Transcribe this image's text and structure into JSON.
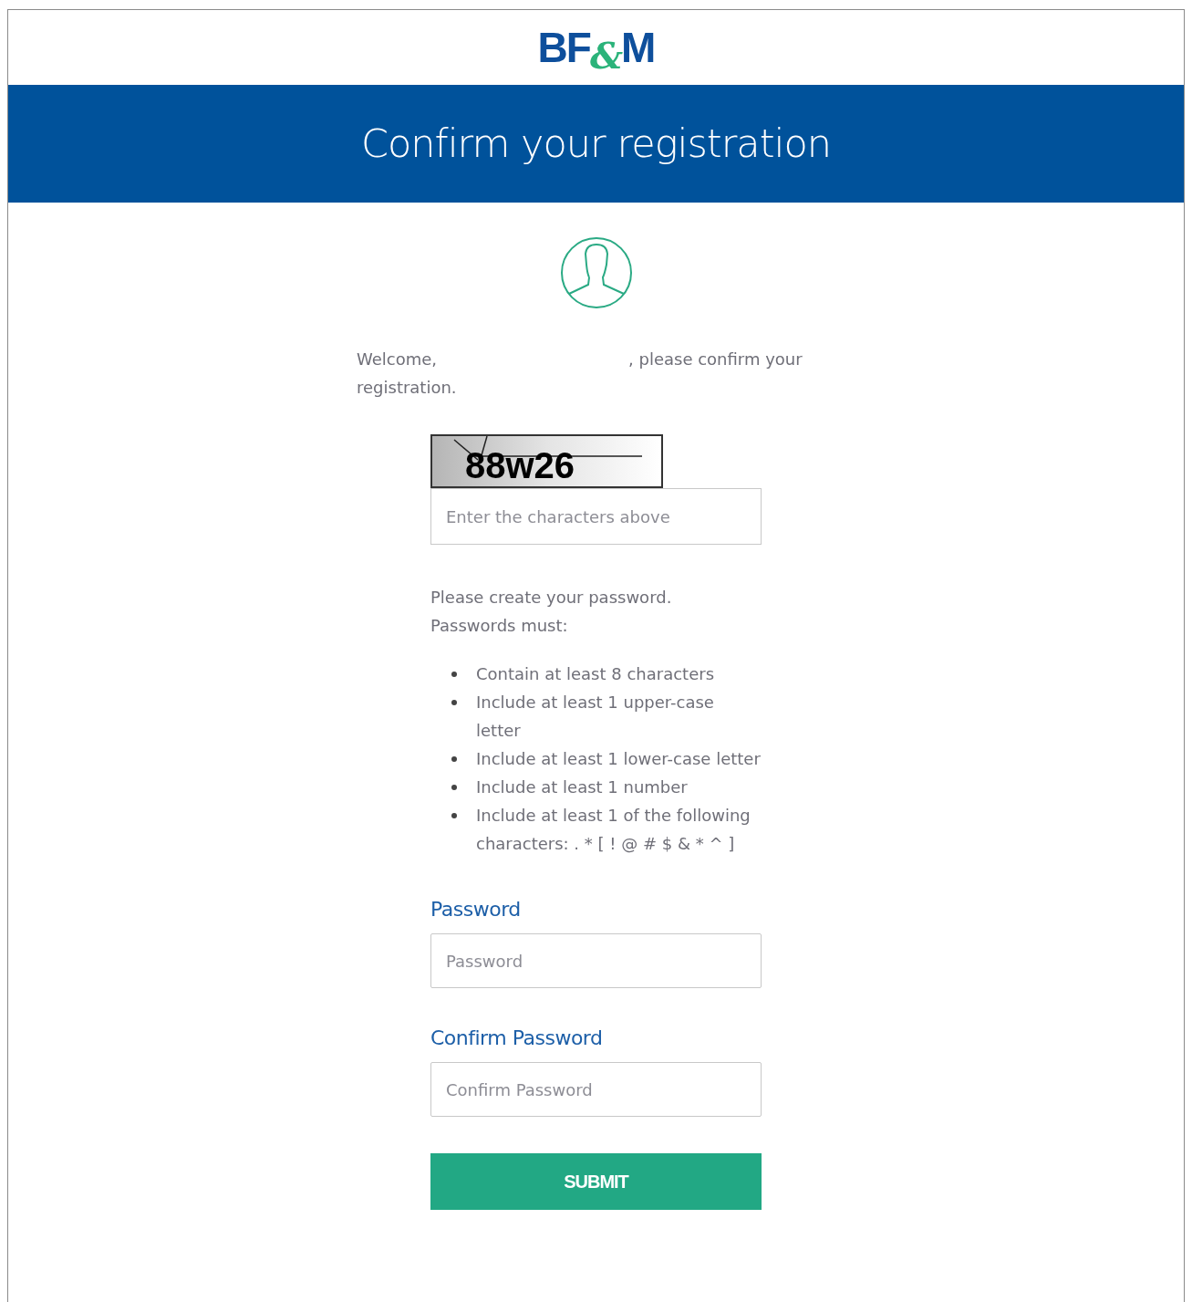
{
  "logo": {
    "parts": [
      {
        "text": "BF",
        "color": "#0e4f9c"
      },
      {
        "text": "&",
        "color": "#2bb37a"
      },
      {
        "text": "M",
        "color": "#0e4f9c"
      }
    ]
  },
  "banner": {
    "title": "Confirm your registration"
  },
  "welcome": {
    "before": "Welcome,",
    "after": ", please confirm your registration."
  },
  "captcha": {
    "text": "88w26",
    "placeholder": "Enter the characters above"
  },
  "instructions": [
    "Please create your password.",
    "Passwords must:"
  ],
  "rules": [
    "Contain at least 8 characters",
    "Include at least 1 upper-case letter",
    "Include at least 1 lower-case letter",
    "Include at least 1 number",
    "Include at least 1 of the following characters: . * [ ! @ # $ & * ^ ]"
  ],
  "fields": [
    {
      "label": "Password",
      "placeholder": "Password"
    },
    {
      "label": "Confirm Password",
      "placeholder": "Confirm Password"
    }
  ],
  "submit": "SUBMIT"
}
